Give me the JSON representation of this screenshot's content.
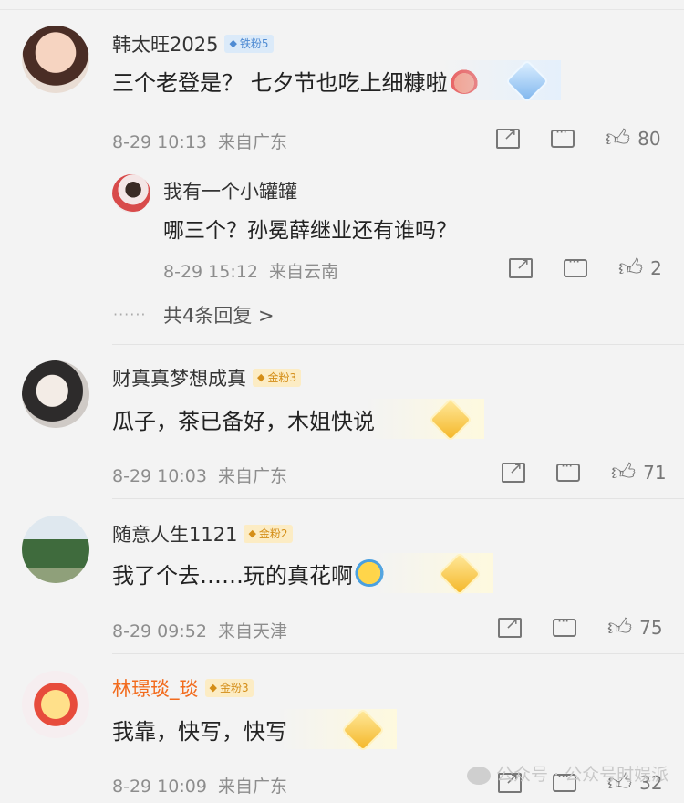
{
  "comments": [
    {
      "name": "韩太旺2025",
      "badge": "铁粉5",
      "text": "三个老登是？ 七夕节也吃上细糠啦",
      "time": "8-29 10:13",
      "location": "来自广东",
      "likes": "80",
      "replies": [
        {
          "name": "我有一个小罐罐",
          "text": "哪三个？孙冕薛继业还有谁吗？",
          "time": "8-29 15:12",
          "location": "来自云南",
          "likes": "2"
        }
      ],
      "more_dots": "······",
      "more_label": "共4条回复 >"
    },
    {
      "name": "财真真梦想成真",
      "badge": "金粉3",
      "text": "瓜子，茶已备好，木姐快说",
      "time": "8-29 10:03",
      "location": "来自广东",
      "likes": "71"
    },
    {
      "name": "随意人生1121",
      "badge": "金粉2",
      "text": "我了个去……玩的真花啊",
      "time": "8-29 09:52",
      "location": "来自天津",
      "likes": "75"
    },
    {
      "name": "林璟琰_琰",
      "badge": "金粉3",
      "text": "我靠，快写，快写",
      "time": "8-29 10:09",
      "location": "来自广东",
      "likes": "32"
    }
  ],
  "watermark": "公众号 · 公众号时娱派",
  "colors": {
    "background": "#f3f3f3",
    "orange_name": "#f26b1d",
    "meta_gray": "#8d8d8d"
  }
}
